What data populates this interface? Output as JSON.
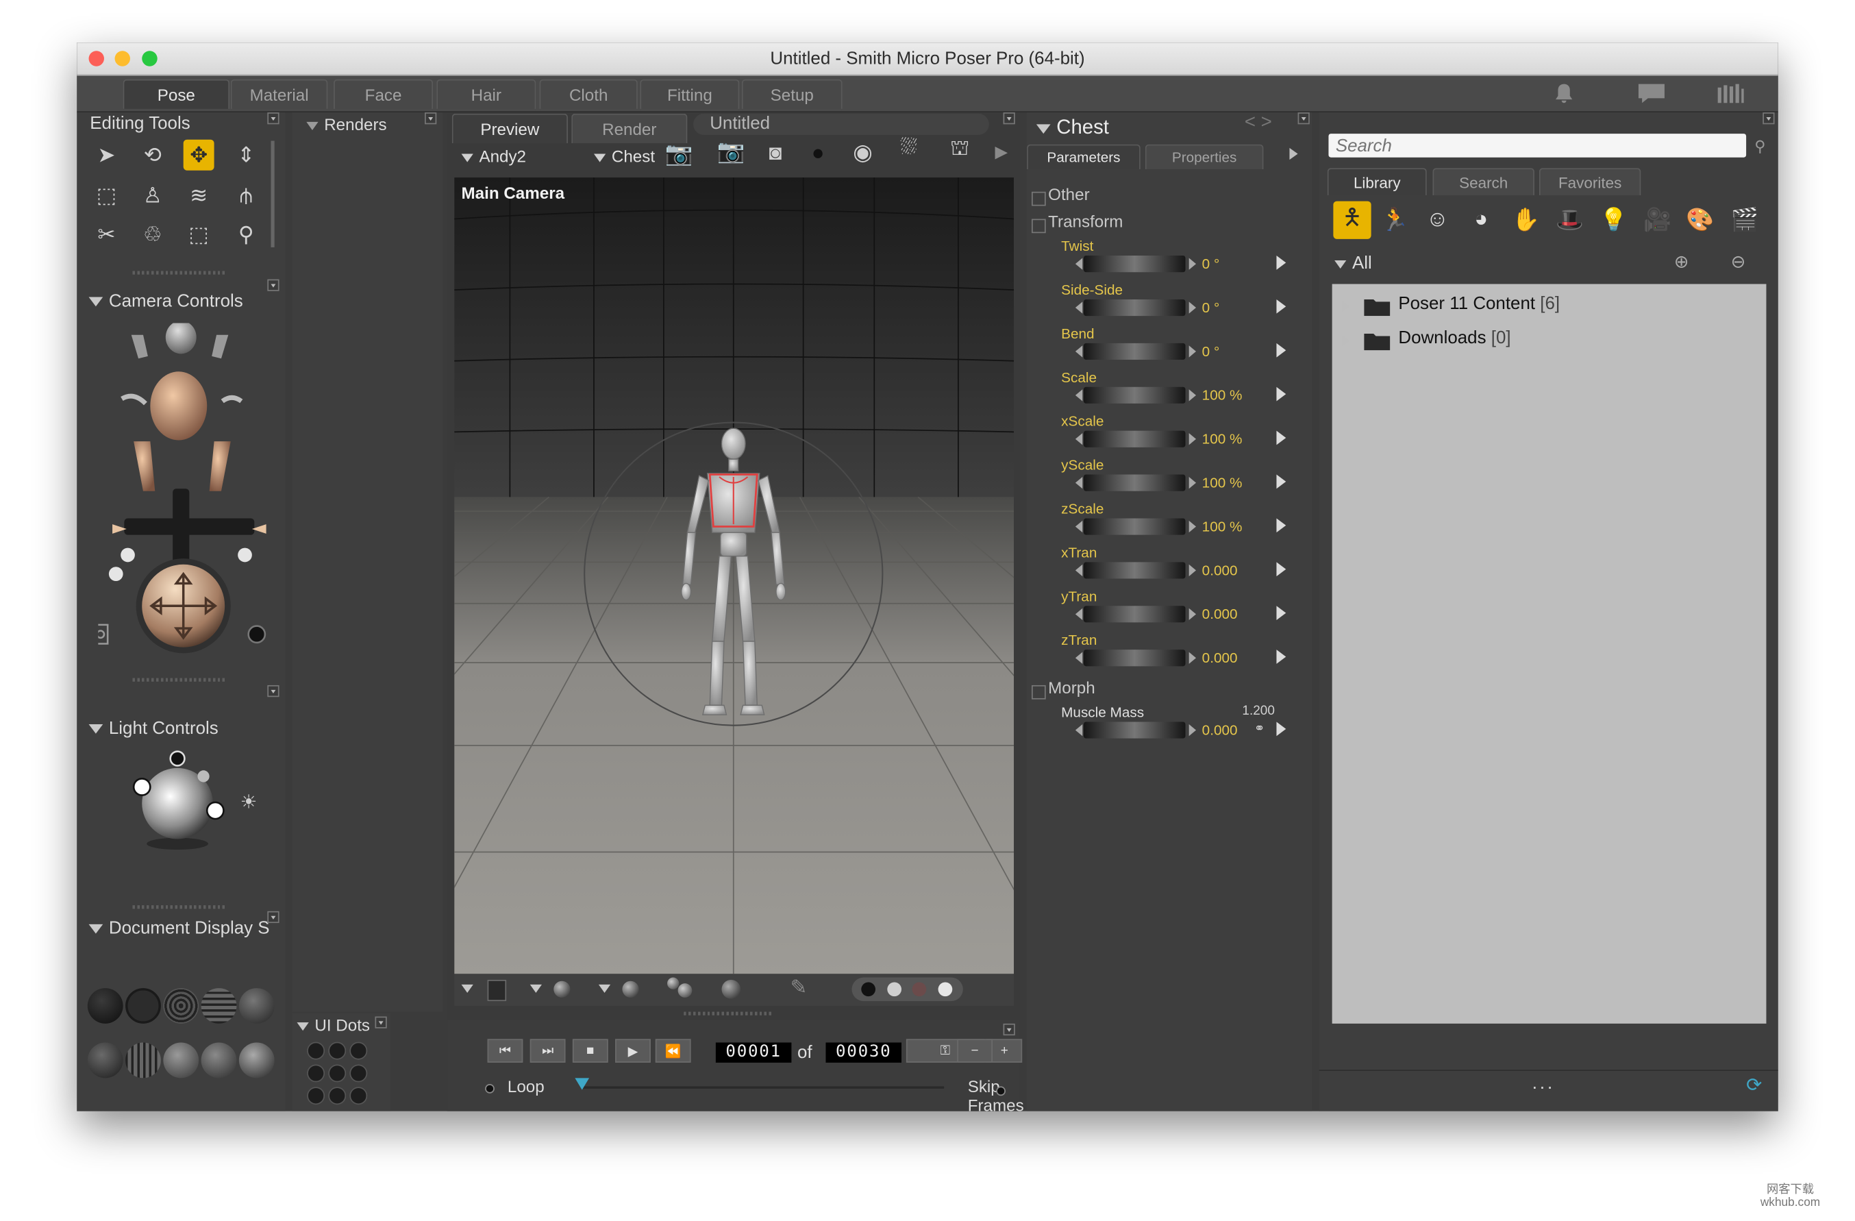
{
  "window": {
    "title": "Untitled - Smith Micro Poser Pro (64-bit)",
    "close_color": "#fc5f57",
    "minimize_color": "#fdbc2e",
    "zoom_color": "#28c840"
  },
  "room_tabs": [
    "Pose",
    "Material",
    "Face",
    "Hair",
    "Cloth",
    "Fitting",
    "Setup"
  ],
  "active_room": "Pose",
  "header_icons": [
    "bell-icon",
    "chat-icon",
    "library-icon"
  ],
  "editing_tools": {
    "title": "Editing Tools",
    "selected_tool": "translate-tool"
  },
  "renders": {
    "title": "Renders"
  },
  "camera_controls": {
    "title": "Camera Controls"
  },
  "light_controls": {
    "title": "Light Controls"
  },
  "document_display": {
    "title": "Document Display S"
  },
  "ui_dots": {
    "title": "UI Dots"
  },
  "document": {
    "tabs": [
      "Preview",
      "Render"
    ],
    "active_tab": "Preview",
    "name": "Untitled",
    "figure": "Andy2",
    "actor": "Chest",
    "camera_label": "Main Camera"
  },
  "playback": {
    "current_frame": "00001",
    "of_label": "of",
    "total_frames": "00030",
    "loop_label": "Loop",
    "skip_frames_label": "Skip Frames"
  },
  "parameters": {
    "actor_title": "Chest",
    "tabs": [
      "Parameters",
      "Properties"
    ],
    "active_tab": "Parameters",
    "groups": {
      "other": "Other",
      "transform": "Transform",
      "morph": "Morph"
    },
    "items": [
      {
        "label": "Twist",
        "value": "0 °"
      },
      {
        "label": "Side-Side",
        "value": "0 °"
      },
      {
        "label": "Bend",
        "value": "0 °"
      },
      {
        "label": "Scale",
        "value": "100 %"
      },
      {
        "label": "xScale",
        "value": "100 %"
      },
      {
        "label": "yScale",
        "value": "100 %"
      },
      {
        "label": "zScale",
        "value": "100 %"
      },
      {
        "label": "xTran",
        "value": "0.000"
      },
      {
        "label": "yTran",
        "value": "0.000"
      },
      {
        "label": "zTran",
        "value": "0.000"
      }
    ],
    "morph": {
      "label": "Muscle Mass",
      "value": "0.000",
      "max": "1.200"
    },
    "label_color_transform": "#e5c64b"
  },
  "library": {
    "search_placeholder": "Search",
    "tabs": [
      "Library",
      "Search",
      "Favorites"
    ],
    "active_tab": "Library",
    "category_icons": [
      "figure-icon",
      "pose-icon",
      "face-icon",
      "hair-icon",
      "hand-icon",
      "props-icon",
      "light-icon",
      "camera-icon",
      "materials-icon",
      "scenes-icon"
    ],
    "filter": "All",
    "items": [
      {
        "name": "Poser 11 Content",
        "count": "[6]"
      },
      {
        "name": "Downloads",
        "count": "[0]"
      }
    ],
    "footer": "..."
  },
  "watermark": {
    "line1": "网客下载",
    "line2": "wkhub.com"
  }
}
